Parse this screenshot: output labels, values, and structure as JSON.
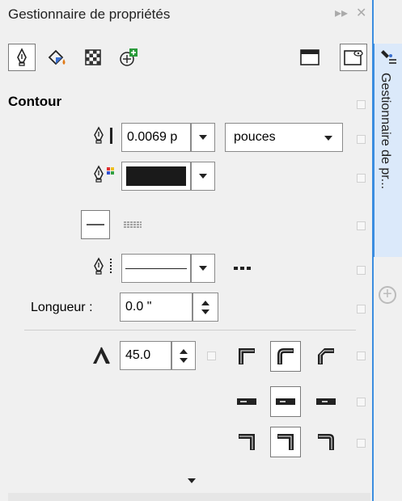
{
  "panel": {
    "title": "Gestionnaire de propriétés",
    "side_tab_label": "Gestionnaire de pr..."
  },
  "toolbar": {
    "icons": [
      "pen-nib-icon",
      "fill-bucket-icon",
      "transparency-icon",
      "add-property-icon"
    ],
    "right_icons": [
      "window-icon",
      "window-eye-icon"
    ]
  },
  "contour": {
    "section_title": "Contour",
    "width_value": "0.0069 p",
    "units_value": "pouces",
    "color_value": "#1a1a1a",
    "length_label": "Longueur :",
    "length_value": "0.0 \"",
    "miter_value": "45.0"
  },
  "colors": {
    "accent": "#3b8de0",
    "side_tab_bg": "#dbe9fa",
    "background": "#f0f0f0"
  }
}
